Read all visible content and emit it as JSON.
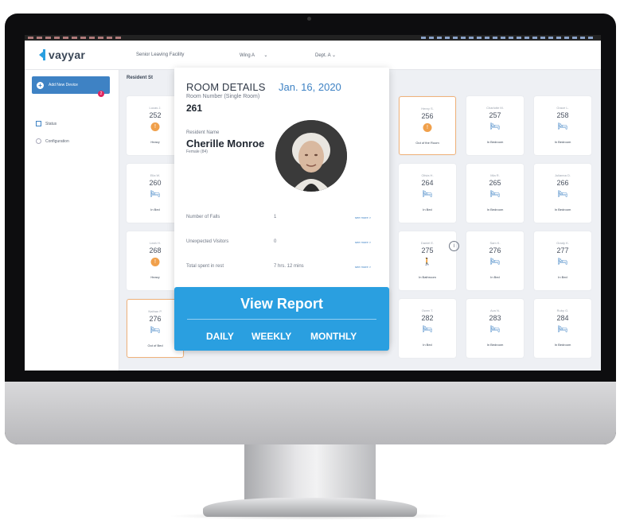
{
  "app": {
    "logo_text": "vayyar",
    "topbar": {
      "facility": "Senior Leaving Facility",
      "wing": "Wing A",
      "dept": "Dept. A"
    },
    "sidebar": {
      "add_button": "Add New Device",
      "items": [
        {
          "label": "Status",
          "badge": "2"
        },
        {
          "label": "Configuration"
        }
      ]
    },
    "section_title": "Resident St",
    "cards": [
      {
        "name": "Lucas J.",
        "room": "252",
        "status": "Heavy",
        "icon": "alert",
        "partial": true
      },
      {
        "name": "Henry S.",
        "room": "256",
        "status": "Out of the Room",
        "icon": "alert",
        "highlight": true
      },
      {
        "name": "Charlotte M.",
        "room": "257",
        "status": "In Bedroom",
        "icon": "bed"
      },
      {
        "name": "Grace L.",
        "room": "258",
        "status": "In Bedroom",
        "icon": "bed"
      },
      {
        "name": "Ella W.",
        "room": "260",
        "status": "In Bed",
        "icon": "bed"
      },
      {
        "name": "Olivia H.",
        "room": "264",
        "status": "In Bed",
        "icon": "bed"
      },
      {
        "name": "Mia R.",
        "room": "265",
        "status": "In Bedroom",
        "icon": "bed"
      },
      {
        "name": "Julianna D.",
        "room": "266",
        "status": "In Bedroom",
        "icon": "bed"
      },
      {
        "name": "Leah H.",
        "room": "268",
        "status": "Heavy",
        "icon": "alert"
      },
      {
        "name": "Daniel E.",
        "room": "275",
        "status": "In Bathroom",
        "icon": "person"
      },
      {
        "name": "Sam K.",
        "room": "276",
        "status": "In Bed",
        "icon": "bed"
      },
      {
        "name": "Grady K.",
        "room": "277",
        "status": "In Bed",
        "icon": "bed"
      },
      {
        "name": "Nathan P.",
        "room": "276",
        "status": "Out of Bed",
        "icon": "bed",
        "highlight": true
      },
      {
        "name": "Owen T.",
        "room": "282",
        "status": "In Bed",
        "icon": "bed"
      },
      {
        "name": "Ava N.",
        "room": "283",
        "status": "In Bedroom",
        "icon": "bed"
      },
      {
        "name": "Ruby G.",
        "room": "284",
        "status": "In Bedroom",
        "icon": "bed"
      }
    ],
    "popup": {
      "title": "ROOM DETAILS",
      "date": "Jan. 16, 2020",
      "room_label": "Room Number (Single Room)",
      "room_number": "261",
      "resident_label": "Resident Name",
      "resident_name": "Cherille Monroe",
      "resident_info": "Female (84)",
      "stats": [
        {
          "label": "Number of Falls",
          "value": "1",
          "more": "see more >"
        },
        {
          "label": "Unexpected Visitors",
          "value": "0",
          "more": "see more >"
        },
        {
          "label": "Total spent in rest",
          "value": "7 hrs. 12 mins",
          "more": "see more >"
        }
      ],
      "report": {
        "title": "View Report",
        "periods": [
          "DAILY",
          "WEEKLY",
          "MONTHLY"
        ]
      }
    },
    "colors": {
      "accent": "#2a9fe0",
      "primary": "#3e82c4",
      "alert": "#f0a04b",
      "badge": "#e0245e"
    }
  }
}
